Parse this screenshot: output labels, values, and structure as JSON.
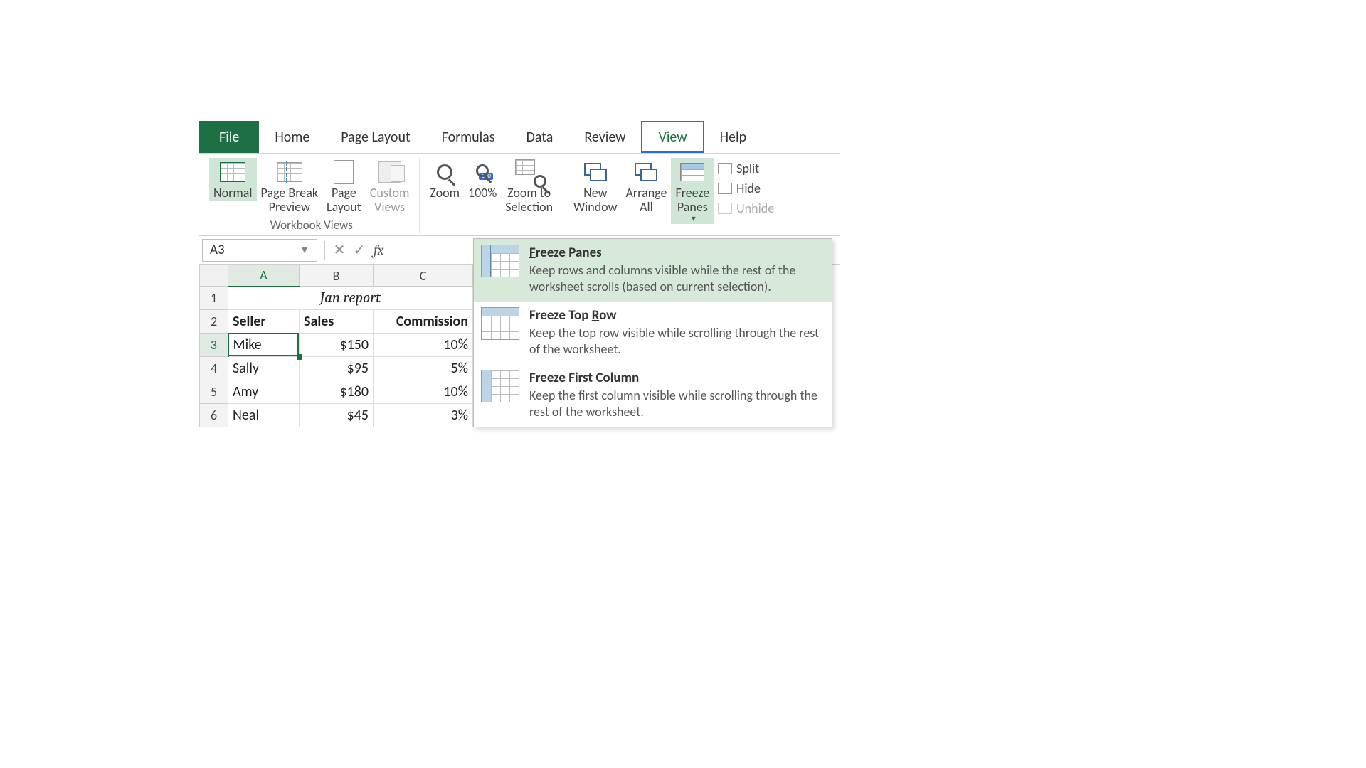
{
  "tabs": {
    "file": "File",
    "home": "Home",
    "page_layout": "Page Layout",
    "formulas": "Formulas",
    "data": "Data",
    "review": "Review",
    "view": "View",
    "help": "Help",
    "active": "View"
  },
  "ribbon": {
    "workbook_views": {
      "label": "Workbook Views",
      "normal": "Normal",
      "page_break_preview": "Page Break\nPreview",
      "page_layout": "Page\nLayout",
      "custom_views": "Custom\nViews"
    },
    "zoom": {
      "zoom": "Zoom",
      "hundred": "100%",
      "zoom_to_selection": "Zoom to\nSelection"
    },
    "window": {
      "new_window": "New\nWindow",
      "arrange_all": "Arrange\nAll",
      "freeze_panes": "Freeze\nPanes",
      "split": "Split",
      "hide": "Hide",
      "unhide": "Unhide"
    }
  },
  "name_box": "A3",
  "fx_symbol": "fx",
  "columns": [
    "A",
    "B",
    "C"
  ],
  "sheet": {
    "title_row": {
      "merged_text": "Jan report"
    },
    "headers": [
      "Seller",
      "Sales",
      "Commission"
    ],
    "rows": [
      {
        "rnum": 3,
        "seller": "Mike",
        "sales": "$150",
        "commission": "10%"
      },
      {
        "rnum": 4,
        "seller": "Sally",
        "sales": "$95",
        "commission": "5%"
      },
      {
        "rnum": 5,
        "seller": "Amy",
        "sales": "$180",
        "commission": "10%"
      },
      {
        "rnum": 6,
        "seller": "Neal",
        "sales": "$45",
        "commission": "3%"
      }
    ],
    "active_cell": "A3"
  },
  "dropdown": {
    "items": [
      {
        "title": "Freeze Panes",
        "underline_char": "F",
        "desc": "Keep rows and columns visible while the rest of the worksheet scrolls (based on current selection)."
      },
      {
        "title": "Freeze Top Row",
        "underline_char": "R",
        "desc": "Keep the top row visible while scrolling through the rest of the worksheet."
      },
      {
        "title": "Freeze First Column",
        "underline_char": "C",
        "desc": "Keep the first column visible while scrolling through the rest of the worksheet."
      }
    ]
  }
}
